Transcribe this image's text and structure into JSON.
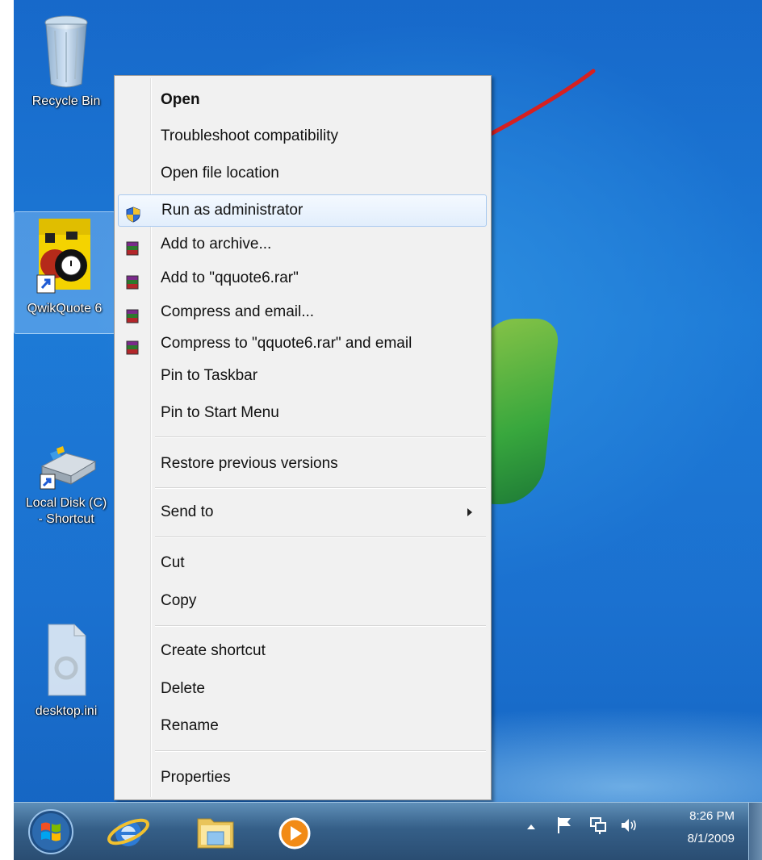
{
  "desktop": {
    "icons": [
      {
        "label": "Recycle Bin"
      },
      {
        "label": "QwikQuote 6"
      },
      {
        "label": "Local Disk (C)\n- Shortcut"
      },
      {
        "label": "desktop.ini"
      }
    ]
  },
  "context_menu": {
    "items": [
      {
        "label": "Open",
        "bold": true
      },
      {
        "label": "Troubleshoot compatibility"
      },
      {
        "label": "Open file location"
      },
      {
        "label": "Run as administrator",
        "icon": "uac-shield-icon",
        "highlighted": true
      },
      {
        "label": "Add to archive...",
        "icon": "winrar-icon"
      },
      {
        "label": "Add to \"qquote6.rar\"",
        "icon": "winrar-icon"
      },
      {
        "label": "Compress and email...",
        "icon": "winrar-icon"
      },
      {
        "label": "Compress to \"qquote6.rar\" and email",
        "icon": "winrar-icon"
      },
      {
        "label": "Pin to Taskbar"
      },
      {
        "label": "Pin to Start Menu"
      },
      {
        "label": "Restore previous versions"
      },
      {
        "label": "Send to",
        "submenu": true
      },
      {
        "label": "Cut"
      },
      {
        "label": "Copy"
      },
      {
        "label": "Create shortcut"
      },
      {
        "label": "Delete"
      },
      {
        "label": "Rename"
      },
      {
        "label": "Properties"
      }
    ]
  },
  "annotation": {
    "arrow_color": "#d62020"
  },
  "taskbar": {
    "buttons": [
      "start-orb-icon",
      "internet-explorer-icon",
      "windows-explorer-icon",
      "media-player-icon"
    ],
    "tray": {
      "icons": [
        "show-hidden-icons-icon",
        "action-center-flag-icon",
        "network-icon",
        "volume-icon"
      ],
      "time": "8:26 PM",
      "date": "8/1/2009"
    }
  }
}
